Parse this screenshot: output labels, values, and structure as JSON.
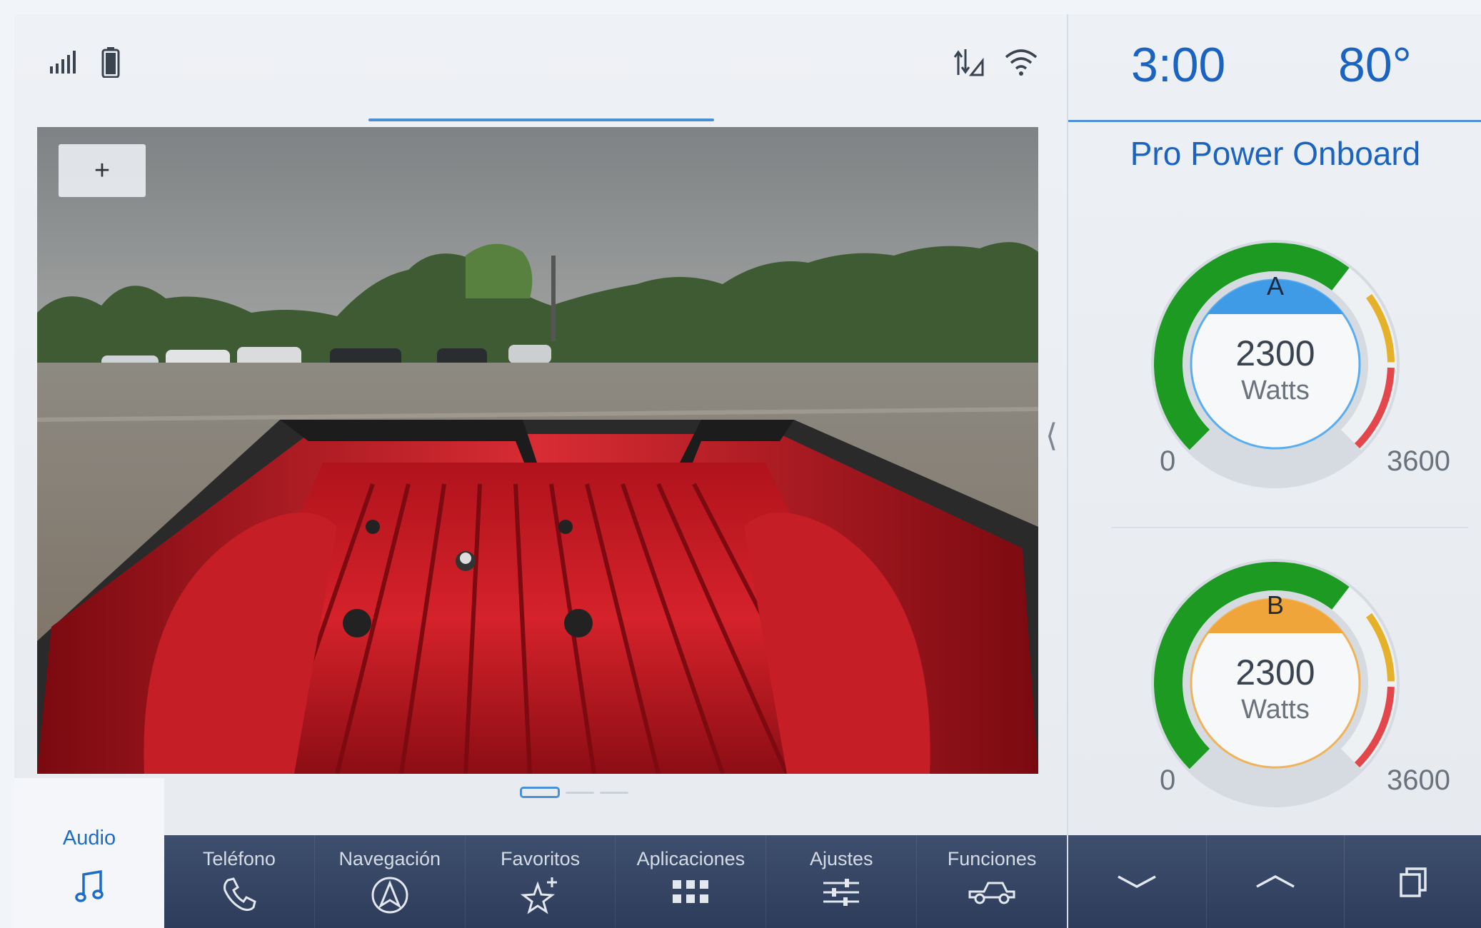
{
  "status": {
    "icons": [
      "signal-strength-icon",
      "phone-battery-icon",
      "data-transfer-icon",
      "wifi-icon"
    ]
  },
  "camera": {
    "zoom_label": "+"
  },
  "audio_tab": {
    "label": "Audio",
    "icon": "music-note-icon"
  },
  "dock": {
    "items": [
      {
        "label": "Teléfono",
        "icon": "phone-icon"
      },
      {
        "label": "Navegación",
        "icon": "navigation-icon"
      },
      {
        "label": "Favoritos",
        "icon": "favorites-star-icon"
      },
      {
        "label": "Aplicaciones",
        "icon": "apps-grid-icon"
      },
      {
        "label": "Ajustes",
        "icon": "settings-sliders-icon"
      },
      {
        "label": "Funciones",
        "icon": "truck-features-icon"
      }
    ]
  },
  "side": {
    "clock": "3:00",
    "temperature": "80°",
    "title": "Pro Power Onboard",
    "gauges": [
      {
        "letter": "A",
        "value": "2300",
        "unit": "Watts",
        "min": "0",
        "max": "3600",
        "level": 0.639,
        "header_color": "#3f9be6",
        "ring_color": "#5aaef0"
      },
      {
        "letter": "B",
        "value": "2300",
        "unit": "Watts",
        "min": "0",
        "max": "3600",
        "level": 0.639,
        "header_color": "#f0a53a",
        "ring_color": "#f0b35a"
      }
    ],
    "dock_icons": [
      "chevron-down-icon",
      "chevron-up-icon",
      "copy-windows-icon"
    ]
  },
  "colors": {
    "accent": "#1b63c1",
    "dock_bg": "#34445f"
  }
}
